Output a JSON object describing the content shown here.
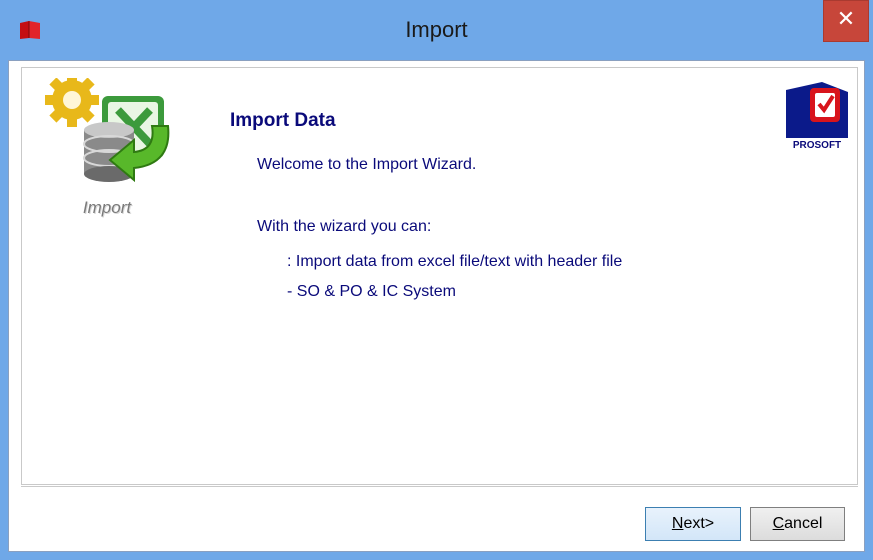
{
  "window": {
    "title": "Import",
    "close_glyph": "✕",
    "app_icon": "book-icon"
  },
  "sidebar": {
    "graphic_icon": "gear-database-excel-arrow-icon",
    "label": "Import"
  },
  "main": {
    "heading": "Import Data",
    "welcome": "Welcome to the Import Wizard.",
    "with_wizard": "With the wizard you can:",
    "bullet1": ": Import data from excel file/text with header file",
    "bullet2": "- SO & PO & IC  System"
  },
  "brand": {
    "name": "PROSOFT",
    "logo_icon": "prosoft-logo-icon"
  },
  "footer": {
    "next_label_first": "N",
    "next_label_rest": "ext>",
    "cancel_label_first": "C",
    "cancel_label_rest": "ancel"
  },
  "colors": {
    "titlebar": "#6fa8e8",
    "close": "#c7463a",
    "text_accent": "#0a0a7a"
  }
}
